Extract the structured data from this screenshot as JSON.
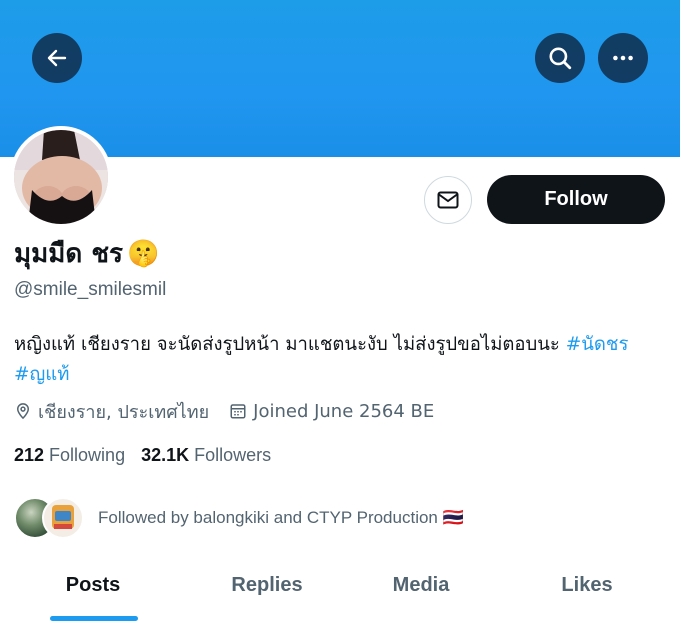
{
  "header": {
    "back_icon": "arrow-left-icon",
    "search_icon": "search-icon",
    "more_icon": "more-horizontal-icon",
    "banner_color": "#1d9ce8"
  },
  "profile": {
    "display_name": "มุมมืด ชร",
    "name_emoji": "🤫",
    "handle": "@smile_smilesmil",
    "bio_text": "หญิงแท้ เชียงราย จะนัดส่งรูปหน้า มาแชตนะงับ ไม่ส่งรูปขอไม่ตอบนะ ",
    "bio_hashtag_1": "#นัดชร",
    "bio_hashtag_2": "#ญแท้",
    "location": "เชียงราย, ประเทศไทย",
    "joined": "Joined June 2564 BE",
    "following_count": "212",
    "following_label": "Following",
    "followers_count": "32.1K",
    "followers_label": "Followers",
    "followed_by": "Followed by balongkiki and CTYP Production 🇹🇭"
  },
  "actions": {
    "message_icon": "mail-icon",
    "follow_label": "Follow"
  },
  "tabs": [
    {
      "label": "Posts",
      "active": true
    },
    {
      "label": "Replies",
      "active": false
    },
    {
      "label": "Media",
      "active": false
    },
    {
      "label": "Likes",
      "active": false
    }
  ],
  "colors": {
    "accent": "#1d9bf0",
    "text_primary": "#0f1419",
    "text_secondary": "#536471",
    "button_dark": "#0f1419"
  }
}
